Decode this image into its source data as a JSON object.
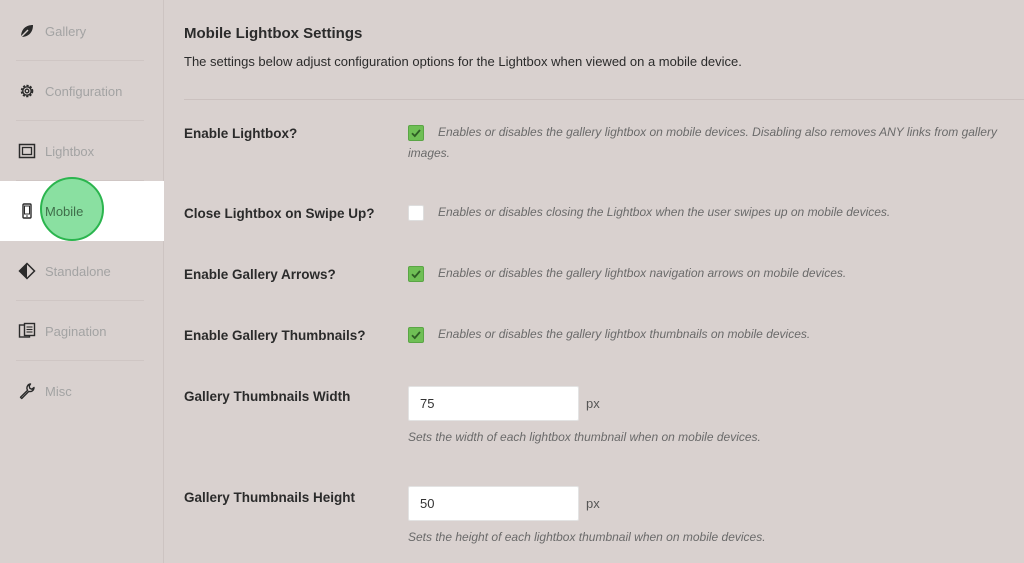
{
  "sidebar": {
    "items": [
      {
        "label": "Gallery",
        "icon": "leaf-icon"
      },
      {
        "label": "Configuration",
        "icon": "gear-icon"
      },
      {
        "label": "Lightbox",
        "icon": "lightbox-icon"
      },
      {
        "label": "Mobile",
        "icon": "mobile-icon"
      },
      {
        "label": "Standalone",
        "icon": "standalone-icon"
      },
      {
        "label": "Pagination",
        "icon": "pagination-icon"
      },
      {
        "label": "Misc",
        "icon": "wrench-icon"
      }
    ],
    "active": "Mobile"
  },
  "main": {
    "title": "Mobile Lightbox Settings",
    "subtitle": "The settings below adjust configuration options for the Lightbox when viewed on a mobile device.",
    "settings": [
      {
        "label": "Enable Lightbox?",
        "checked": true,
        "desc": "Enables or disables the gallery lightbox on mobile devices. Disabling also removes ANY links from gallery images."
      },
      {
        "label": "Close Lightbox on Swipe Up?",
        "checked": false,
        "desc": "Enables or disables closing the Lightbox when the user swipes up on mobile devices."
      },
      {
        "label": "Enable Gallery Arrows?",
        "checked": true,
        "desc": "Enables or disables the gallery lightbox navigation arrows on mobile devices."
      },
      {
        "label": "Enable Gallery Thumbnails?",
        "checked": true,
        "desc": "Enables or disables the gallery lightbox thumbnails on mobile devices."
      }
    ],
    "thumb_width": {
      "label": "Gallery Thumbnails Width",
      "value": "75",
      "unit": "px",
      "help": "Sets the width of each lightbox thumbnail when on mobile devices."
    },
    "thumb_height": {
      "label": "Gallery Thumbnails Height",
      "value": "50",
      "unit": "px",
      "help": "Sets the height of each lightbox thumbnail when on mobile devices."
    }
  },
  "colors": {
    "background": "#d9d1cf",
    "active_item_bg": "#ffffff",
    "checkbox_on": "#6fbf55",
    "highlight": "#8ae0a1",
    "highlight_border": "#2bb54e"
  }
}
